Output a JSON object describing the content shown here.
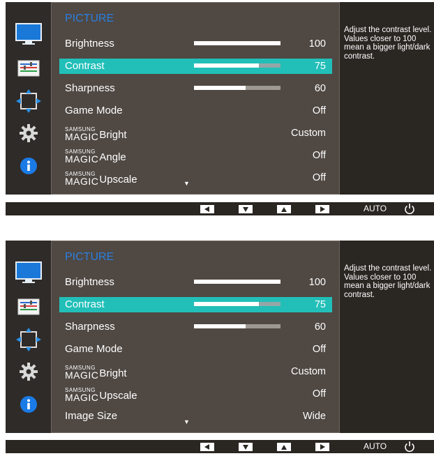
{
  "osd1": {
    "title": "PICTURE",
    "rows": [
      {
        "label": "Brightness",
        "value": "100",
        "bar": 1.0
      },
      {
        "label": "Contrast",
        "value": "75",
        "bar": 0.75
      },
      {
        "label": "Sharpness",
        "value": "60",
        "bar": 0.6
      },
      {
        "label": "Game Mode",
        "value": "Off"
      },
      {
        "brand_top": "SAMSUNG",
        "brand_bottom": "MAGIC",
        "label": "Bright",
        "value": "Custom"
      },
      {
        "brand_top": "SAMSUNG",
        "brand_bottom": "MAGIC",
        "label": "Angle",
        "value": "Off"
      },
      {
        "brand_top": "SAMSUNG",
        "brand_bottom": "MAGIC",
        "label": "Upscale",
        "value": "Off"
      }
    ],
    "selected_index": 1,
    "help_text": "Adjust the contrast level. Values closer to 100 mean a bigger light/dark contrast."
  },
  "osd2": {
    "title": "PICTURE",
    "rows": [
      {
        "label": "Brightness",
        "value": "100",
        "bar": 1.0
      },
      {
        "label": "Contrast",
        "value": "75",
        "bar": 0.75
      },
      {
        "label": "Sharpness",
        "value": "60",
        "bar": 0.6
      },
      {
        "label": "Game Mode",
        "value": "Off"
      },
      {
        "brand_top": "SAMSUNG",
        "brand_bottom": "MAGIC",
        "label": "Bright",
        "value": "Custom"
      },
      {
        "brand_top": "SAMSUNG",
        "brand_bottom": "MAGIC",
        "label": "Upscale",
        "value": "Off"
      },
      {
        "label": "Image Size",
        "value": "Wide"
      }
    ],
    "selected_index": 1,
    "help_text": "Adjust the contrast level. Values closer to 100 mean a bigger light/dark contrast."
  },
  "buttons": {
    "left": "left-arrow-icon",
    "down": "down-arrow-icon",
    "up": "up-arrow-icon",
    "right": "right-arrow-icon",
    "auto_label": "AUTO",
    "power": "power-icon"
  },
  "sidebar_icons": [
    "monitor-icon",
    "color-settings-icon",
    "size-position-icon",
    "gear-icon",
    "info-icon"
  ],
  "colors": {
    "title": "#2a7fe0",
    "selected": "#21bfb8",
    "menu_bg": "#4f4843",
    "frame_bg": "#2a2622"
  }
}
